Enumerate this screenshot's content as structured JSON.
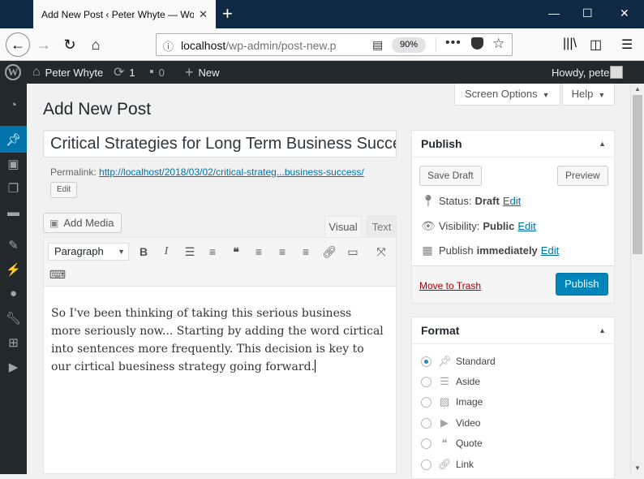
{
  "browser": {
    "tab_title": "Add New Post ‹ Peter Whyte — Wo",
    "tab_close": "✕",
    "new_tab": "+",
    "url_host": "localhost",
    "url_path": "/wp-admin/post-new.p",
    "zoom": "90%",
    "page_actions": "•••"
  },
  "adminbar": {
    "site_name": "Peter Whyte",
    "updates_count": "1",
    "comments_count": "0",
    "new_label": "New",
    "howdy": "Howdy, pete"
  },
  "header": {
    "screen_options": "Screen Options",
    "help": "Help",
    "page_title": "Add New Post"
  },
  "post": {
    "title": "Critical Strategies for Long Term Business Success",
    "permalink_label": "Permalink:",
    "permalink_url": "http://localhost/2018/03/02/critical-strateg...business-success/",
    "permalink_edit": "Edit",
    "add_media": "Add Media",
    "tab_visual": "Visual",
    "tab_text": "Text",
    "format_select": "Paragraph",
    "body": "So I've been thinking of taking this serious business more seriously now... Starting by adding the word cirtical into sentences more frequently. This decision is key to our cirtical buesiness strategy going forward."
  },
  "publish_box": {
    "title": "Publish",
    "save_draft": "Save Draft",
    "preview": "Preview",
    "status_label": "Status:",
    "status_value": "Draft",
    "status_edit": "Edit",
    "visibility_label": "Visibility:",
    "visibility_value": "Public",
    "visibility_edit": "Edit",
    "publish_label": "Publish",
    "publish_value": "immediately",
    "publish_edit": "Edit",
    "trash": "Move to Trash",
    "publish_button": "Publish"
  },
  "format_box": {
    "title": "Format",
    "options": [
      {
        "label": "Standard",
        "checked": true
      },
      {
        "label": "Aside",
        "checked": false
      },
      {
        "label": "Image",
        "checked": false
      },
      {
        "label": "Video",
        "checked": false
      },
      {
        "label": "Quote",
        "checked": false
      },
      {
        "label": "Link",
        "checked": false
      }
    ]
  },
  "colors": {
    "admin_bar": "#23282d",
    "accent": "#0073aa",
    "primary_button": "#0085ba",
    "trash": "#aa0000",
    "browser_titlebar": "#0f2844"
  }
}
